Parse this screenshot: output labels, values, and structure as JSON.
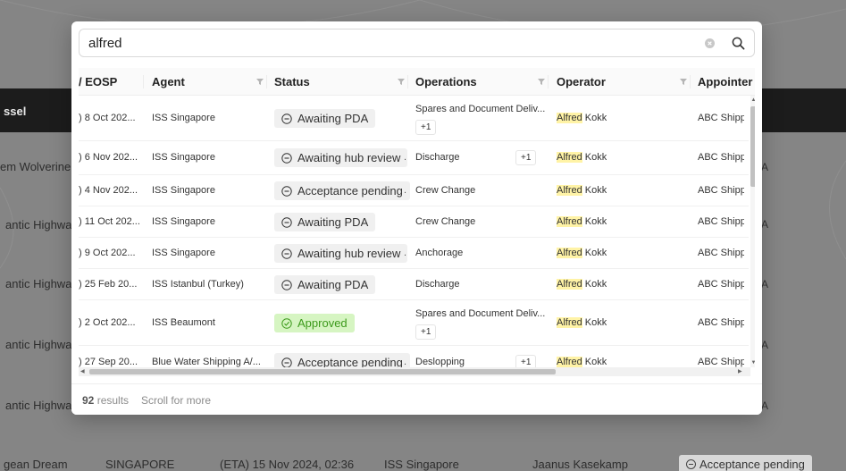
{
  "background": {
    "header_label": "ssel",
    "rows": [
      {
        "text": "em Wolverine",
        "top": 0
      },
      {
        "text": "antic Highway"
      },
      {
        "text": "antic Highway"
      },
      {
        "text": "antic Highway"
      },
      {
        "text": "antic Highway"
      }
    ],
    "bottom_row": {
      "vessel": "gean Dream",
      "port": "SINGAPORE",
      "eta": "(ETA) 15 Nov 2024, 02:36",
      "agent": "ISS Singapore",
      "operator": "Jaanus Kasekamp",
      "status": "Acceptance pending"
    },
    "edge_letter": "A"
  },
  "search": {
    "value": "alfred",
    "clear_icon": "clear-circle-icon",
    "search_icon": "search-icon"
  },
  "columns": {
    "eosp": "/ EOSP",
    "agent": "Agent",
    "status": "Status",
    "operations": "Operations",
    "operator": "Operator",
    "appointer": "Appointer"
  },
  "rows": [
    {
      "eosp": ") 8 Oct 202...",
      "agent": "ISS Singapore",
      "status": "Awaiting PDA",
      "status_type": "pending",
      "dot": false,
      "ops": "Spares and Document Deliv...",
      "ops_plus": "+1",
      "plus_inline": false,
      "op_hl": "Alfred",
      "op_rest": " Kokk",
      "appointer": "ABC Shippi"
    },
    {
      "eosp": ") 6 Nov 202...",
      "agent": "ISS Singapore",
      "status": "Awaiting hub review",
      "status_type": "pending",
      "dot": true,
      "ops": "Discharge",
      "ops_plus": "+1",
      "plus_inline": true,
      "op_hl": "Alfred",
      "op_rest": " Kokk",
      "appointer": "ABC Shippi"
    },
    {
      "eosp": ") 4 Nov 202...",
      "agent": "ISS Singapore",
      "status": "Acceptance pending",
      "status_type": "pending",
      "dot": true,
      "ops": "Crew Change",
      "ops_plus": "",
      "plus_inline": false,
      "op_hl": "Alfred",
      "op_rest": " Kokk",
      "appointer": "ABC Shippi"
    },
    {
      "eosp": ") 11 Oct 202...",
      "agent": "ISS Singapore",
      "status": "Awaiting PDA",
      "status_type": "pending",
      "dot": false,
      "ops": "Crew Change",
      "ops_plus": "",
      "plus_inline": false,
      "op_hl": "Alfred",
      "op_rest": " Kokk",
      "appointer": "ABC Shippi"
    },
    {
      "eosp": ") 9 Oct 202...",
      "agent": "ISS Singapore",
      "status": "Awaiting hub review",
      "status_type": "pending",
      "dot": true,
      "ops": "Anchorage",
      "ops_plus": "",
      "plus_inline": false,
      "op_hl": "Alfred",
      "op_rest": " Kokk",
      "appointer": "ABC Shippi"
    },
    {
      "eosp": ") 25 Feb 20...",
      "agent": "ISS Istanbul (Turkey)",
      "status": "Awaiting PDA",
      "status_type": "pending",
      "dot": false,
      "ops": "Discharge",
      "ops_plus": "",
      "plus_inline": false,
      "op_hl": "Alfred",
      "op_rest": " Kokk",
      "appointer": "ABC Shippi"
    },
    {
      "eosp": ") 2 Oct 202...",
      "agent": "ISS Beaumont",
      "status": "Approved",
      "status_type": "approved",
      "dot": false,
      "ops": "Spares and Document Deliv...",
      "ops_plus": "+1",
      "plus_inline": false,
      "op_hl": "Alfred",
      "op_rest": " Kokk",
      "appointer": "ABC Shippi"
    },
    {
      "eosp": ") 27 Sep 20...",
      "agent": "Blue Water Shipping A/...",
      "status": "Acceptance pending",
      "status_type": "pending",
      "dot": true,
      "ops": "Deslopping",
      "ops_plus": "+1",
      "plus_inline": true,
      "op_hl": "Alfred",
      "op_rest": " Kokk",
      "appointer": "ABC Shippi"
    }
  ],
  "footer": {
    "count": "92",
    "results_label": "results",
    "more_label": "Scroll for more"
  },
  "colors": {
    "highlight": "#fff3a6",
    "approved_bg": "#d6f5c2",
    "approved_text": "#3c9a1b",
    "header_bar": "#1c1c1c"
  }
}
